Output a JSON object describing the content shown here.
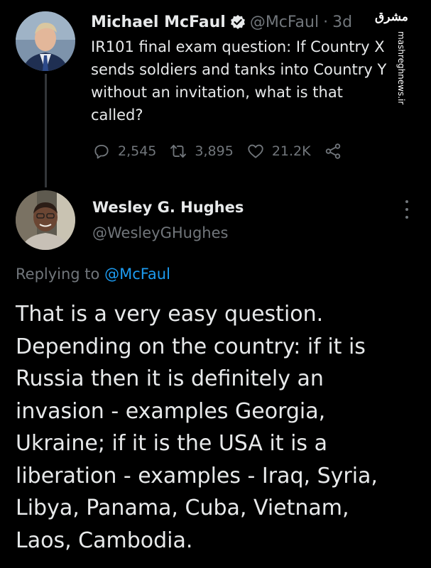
{
  "watermark": {
    "logo_text": "مشرق",
    "site": "mashreghnews.ir"
  },
  "tweet": {
    "author_name": "Michael McFaul",
    "author_handle": "@McFaul",
    "separator": "·",
    "time": "3d",
    "lines": [
      "IR101 final exam question: If Country X",
      "sends soldiers and tanks into Country Y",
      "without an invitation, what is that",
      "called?"
    ],
    "replies": "2,545",
    "retweets": "3,895",
    "likes": "21.2K",
    "icons": {
      "reply": "reply-icon",
      "retweet": "retweet-icon",
      "like": "heart-icon",
      "share": "share-icon",
      "verified": "verified-badge-icon"
    }
  },
  "reply": {
    "author_name": "Wesley G. Hughes",
    "author_handle": "@WesleyGHughes",
    "replying_prefix": "Replying to",
    "replying_to": "@McFaul",
    "lines": [
      "That is a very easy question.",
      "Depending on the country: if it is",
      "Russia then it is definitely an",
      "invasion - examples Georgia,",
      "Ukraine; if it is the USA it is a",
      "liberation - examples - Iraq, Syria,",
      "Libya, Panama, Cuba, Vietnam,",
      "Laos, Cambodia."
    ]
  },
  "colors": {
    "background": "#000000",
    "text_primary": "#e7e9ea",
    "text_secondary": "#71767b",
    "accent": "#1d9bf0"
  }
}
